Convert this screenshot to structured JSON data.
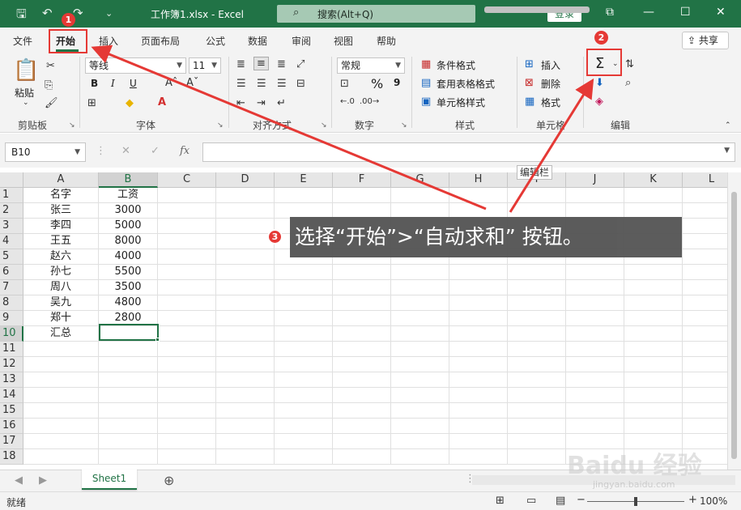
{
  "titlebar": {
    "title": "工作簿1.xlsx  -  Excel",
    "search": "搜索(Alt+Q)",
    "login": "登录",
    "icons": [
      "save-icon",
      "undo-icon",
      "redo-icon",
      "customize-icon",
      "ribbon-display-icon",
      "minimize-icon",
      "maximize-icon",
      "close-icon"
    ]
  },
  "tabs": [
    "文件",
    "开始",
    "插入",
    "页面布局",
    "公式",
    "数据",
    "审阅",
    "视图",
    "帮助"
  ],
  "share": "共享",
  "ribbon": {
    "clipboard": {
      "paste": "粘贴",
      "label": "剪贴板"
    },
    "font": {
      "name": "等线",
      "size": "11",
      "label": "字体",
      "bold": "B",
      "italic": "I",
      "underline": "U"
    },
    "alignment": {
      "label": "对齐方式"
    },
    "number": {
      "format": "常规",
      "label": "数字",
      "percent": "%",
      "comma": "9"
    },
    "styles": {
      "conditional": "条件格式",
      "table": "套用表格格式",
      "cell": "单元格样式",
      "label": "样式"
    },
    "cells": {
      "insert": "插入",
      "delete": "删除",
      "format": "格式",
      "label": "单元格"
    },
    "editing": {
      "autosum": "Σ",
      "label": "编辑"
    }
  },
  "formula_bar": {
    "name_box": "B10",
    "fx": "fx",
    "cancel": "✕",
    "enter": "✓",
    "tooltip": "编辑栏"
  },
  "sheet": {
    "columns": [
      "A",
      "B",
      "C",
      "D",
      "E",
      "F",
      "G",
      "H",
      "I",
      "J",
      "K",
      "L"
    ],
    "rows": [
      "1",
      "2",
      "3",
      "4",
      "5",
      "6",
      "7",
      "8",
      "9",
      "10",
      "11",
      "12",
      "13",
      "14",
      "15",
      "16",
      "17",
      "18"
    ],
    "data": [
      [
        "名字",
        "工资"
      ],
      [
        "张三",
        "3000"
      ],
      [
        "李四",
        "5000"
      ],
      [
        "王五",
        "8000"
      ],
      [
        "赵六",
        "4000"
      ],
      [
        "孙七",
        "5500"
      ],
      [
        "周八",
        "3500"
      ],
      [
        "吴九",
        "4800"
      ],
      [
        "郑十",
        "2800"
      ],
      [
        "汇总",
        ""
      ]
    ],
    "active_cell": "B10"
  },
  "sheet_tabs": {
    "tab": "Sheet1",
    "add": "⊕"
  },
  "status": {
    "ready": "就绪",
    "zoom": "100%",
    "minus": "−",
    "plus": "+"
  },
  "annotations": {
    "badge1": "1",
    "badge2": "2",
    "badge3": "3",
    "callout": "选择“开始”>“自动求和” 按钮。",
    "accent_color": "#e53935"
  },
  "watermark": {
    "logo": "Baidu 经验",
    "url": "jingyan.baidu.com"
  },
  "colors": {
    "excel_green": "#217346",
    "ribbon_bg": "#f3f3f3"
  }
}
